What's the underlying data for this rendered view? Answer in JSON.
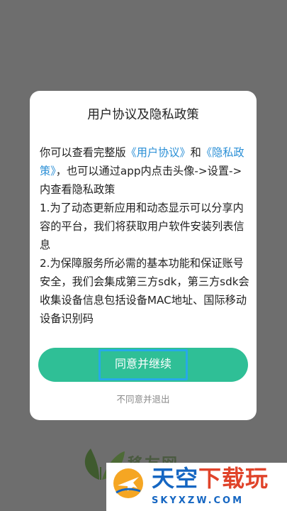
{
  "background": {
    "app_name_partial": "移友网"
  },
  "dialog": {
    "title": "用户协议及隐私政策",
    "intro_prefix": "你可以查看完整版",
    "user_agreement_link": "《用户协议》",
    "intro_and": "和",
    "privacy_policy_link": "《隐私政策》",
    "intro_suffix": "，也可以通过app内点击头像->设置->内查看隐私政策",
    "item_1": "1.为了动态更新应用和动态显示可以分享内容的平台，我们将获取用户软件安装列表信息",
    "item_2": "2.为保障服务所必需的基本功能和保证账号安全，我们会集成第三方sdk，第三方sdk会收集设备信息包括设备MAC地址、国际移动设备识别码",
    "agree_label": "同意并继续",
    "disagree_label": "不同意并退出"
  },
  "watermark": {
    "brand_main": "天空",
    "brand_accent": "下载玩",
    "brand_sub": "SKYXZW.COM"
  },
  "colors": {
    "accent_green": "#2fbf96",
    "link_blue": "#2a8fd6",
    "overlay_gray": "#6e6e6e"
  }
}
